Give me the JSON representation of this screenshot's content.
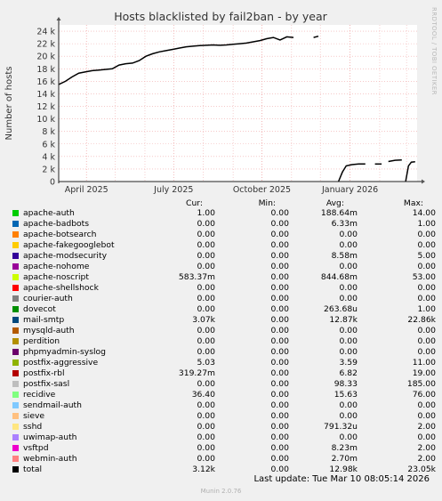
{
  "chart_data": {
    "type": "line",
    "title": "Hosts blacklisted by fail2ban - by year",
    "ylabel": "Number of hosts",
    "ylim": [
      0,
      25000
    ],
    "y_ticks": [
      0,
      2000,
      4000,
      6000,
      8000,
      10000,
      12000,
      14000,
      16000,
      18000,
      20000,
      22000,
      24000
    ],
    "y_tick_labels": [
      "0",
      "2 k",
      "4 k",
      "6 k",
      "8 k",
      "10 k",
      "12 k",
      "14 k",
      "16 k",
      "18 k",
      "20 k",
      "22 k",
      "24 k"
    ],
    "x_range": [
      "2025-03-03",
      "2026-03-12"
    ],
    "x_ticks": [
      "2025-04-01",
      "2025-07-01",
      "2025-10-01",
      "2026-01-01"
    ],
    "x_tick_labels": [
      "April 2025",
      "July 2025",
      "October 2025",
      "January 2026"
    ],
    "grid": true,
    "series": [
      {
        "name": "total",
        "color": "#000000",
        "points": [
          [
            "2025-03-03",
            15500
          ],
          [
            "2025-03-10",
            16000
          ],
          [
            "2025-03-17",
            16700
          ],
          [
            "2025-03-24",
            17300
          ],
          [
            "2025-03-31",
            17500
          ],
          [
            "2025-04-07",
            17700
          ],
          [
            "2025-04-14",
            17800
          ],
          [
            "2025-04-21",
            17900
          ],
          [
            "2025-04-28",
            18000
          ],
          [
            "2025-05-05",
            18600
          ],
          [
            "2025-05-12",
            18800
          ],
          [
            "2025-05-19",
            18900
          ],
          [
            "2025-05-26",
            19300
          ],
          [
            "2025-06-02",
            20000
          ],
          [
            "2025-06-09",
            20400
          ],
          [
            "2025-06-16",
            20700
          ],
          [
            "2025-06-23",
            20900
          ],
          [
            "2025-06-30",
            21100
          ],
          [
            "2025-07-07",
            21300
          ],
          [
            "2025-07-14",
            21500
          ],
          [
            "2025-07-21",
            21600
          ],
          [
            "2025-07-28",
            21700
          ],
          [
            "2025-08-04",
            21750
          ],
          [
            "2025-08-11",
            21800
          ],
          [
            "2025-08-18",
            21750
          ],
          [
            "2025-08-25",
            21800
          ],
          [
            "2025-09-01",
            21900
          ],
          [
            "2025-09-08",
            22000
          ],
          [
            "2025-09-15",
            22100
          ],
          [
            "2025-09-22",
            22300
          ],
          [
            "2025-09-29",
            22500
          ],
          [
            "2025-10-06",
            22800
          ],
          [
            "2025-10-13",
            23000
          ],
          [
            "2025-10-20",
            22600
          ],
          [
            "2025-10-27",
            23100
          ],
          [
            "2025-11-03",
            23000
          ],
          null,
          [
            "2025-11-24",
            23000
          ],
          [
            "2025-11-29",
            23200
          ],
          null,
          [
            "2025-12-20",
            0
          ],
          [
            "2025-12-24",
            1500
          ],
          [
            "2025-12-28",
            2500
          ],
          [
            "2026-01-03",
            2700
          ],
          [
            "2026-01-10",
            2800
          ],
          [
            "2026-01-17",
            2800
          ],
          null,
          [
            "2026-01-27",
            2800
          ],
          [
            "2026-02-03",
            2800
          ],
          null,
          [
            "2026-02-10",
            3200
          ],
          [
            "2026-02-17",
            3400
          ],
          [
            "2026-02-24",
            3450
          ],
          null,
          [
            "2026-02-28",
            0
          ],
          [
            "2026-03-03",
            2500
          ],
          [
            "2026-03-06",
            3100
          ],
          [
            "2026-03-10",
            3150
          ]
        ]
      }
    ]
  },
  "legend": {
    "headers": [
      "Cur:",
      "Min:",
      "Avg:",
      "Max:"
    ],
    "rows": [
      {
        "name": "apache-auth",
        "color": "#00cc00",
        "cur": "1.00",
        "min": "0.00",
        "avg": "188.64m",
        "max": "14.00"
      },
      {
        "name": "apache-badbots",
        "color": "#0066b3",
        "cur": "0.00",
        "min": "0.00",
        "avg": "6.33m",
        "max": "1.00"
      },
      {
        "name": "apache-botsearch",
        "color": "#ff8000",
        "cur": "0.00",
        "min": "0.00",
        "avg": "0.00",
        "max": "0.00"
      },
      {
        "name": "apache-fakegooglebot",
        "color": "#ffcc00",
        "cur": "0.00",
        "min": "0.00",
        "avg": "0.00",
        "max": "0.00"
      },
      {
        "name": "apache-modsecurity",
        "color": "#330099",
        "cur": "0.00",
        "min": "0.00",
        "avg": "8.58m",
        "max": "5.00"
      },
      {
        "name": "apache-nohome",
        "color": "#990099",
        "cur": "0.00",
        "min": "0.00",
        "avg": "0.00",
        "max": "0.00"
      },
      {
        "name": "apache-noscript",
        "color": "#ccff00",
        "cur": "583.37m",
        "min": "0.00",
        "avg": "844.68m",
        "max": "53.00"
      },
      {
        "name": "apache-shellshock",
        "color": "#ff0000",
        "cur": "0.00",
        "min": "0.00",
        "avg": "0.00",
        "max": "0.00"
      },
      {
        "name": "courier-auth",
        "color": "#808080",
        "cur": "0.00",
        "min": "0.00",
        "avg": "0.00",
        "max": "0.00"
      },
      {
        "name": "dovecot",
        "color": "#008f00",
        "cur": "0.00",
        "min": "0.00",
        "avg": "263.68u",
        "max": "1.00"
      },
      {
        "name": "mail-smtp",
        "color": "#00487d",
        "cur": "3.07k",
        "min": "0.00",
        "avg": "12.87k",
        "max": "22.86k"
      },
      {
        "name": "mysqld-auth",
        "color": "#b35a00",
        "cur": "0.00",
        "min": "0.00",
        "avg": "0.00",
        "max": "0.00"
      },
      {
        "name": "perdition",
        "color": "#b38f00",
        "cur": "0.00",
        "min": "0.00",
        "avg": "0.00",
        "max": "0.00"
      },
      {
        "name": "phpmyadmin-syslog",
        "color": "#6b006b",
        "cur": "0.00",
        "min": "0.00",
        "avg": "0.00",
        "max": "0.00"
      },
      {
        "name": "postfix-aggressive",
        "color": "#8fb300",
        "cur": "5.03",
        "min": "0.00",
        "avg": "3.59",
        "max": "11.00"
      },
      {
        "name": "postfix-rbl",
        "color": "#b30000",
        "cur": "319.27m",
        "min": "0.00",
        "avg": "6.82",
        "max": "19.00"
      },
      {
        "name": "postfix-sasl",
        "color": "#bebebe",
        "cur": "0.00",
        "min": "0.00",
        "avg": "98.33",
        "max": "185.00"
      },
      {
        "name": "recidive",
        "color": "#80ff80",
        "cur": "36.40",
        "min": "0.00",
        "avg": "15.63",
        "max": "76.00"
      },
      {
        "name": "sendmail-auth",
        "color": "#80c9ff",
        "cur": "0.00",
        "min": "0.00",
        "avg": "0.00",
        "max": "0.00"
      },
      {
        "name": "sieve",
        "color": "#ffc080",
        "cur": "0.00",
        "min": "0.00",
        "avg": "0.00",
        "max": "0.00"
      },
      {
        "name": "sshd",
        "color": "#ffe680",
        "cur": "0.00",
        "min": "0.00",
        "avg": "791.32u",
        "max": "2.00"
      },
      {
        "name": "uwimap-auth",
        "color": "#aa80ff",
        "cur": "0.00",
        "min": "0.00",
        "avg": "0.00",
        "max": "0.00"
      },
      {
        "name": "vsftpd",
        "color": "#ee00cc",
        "cur": "0.00",
        "min": "0.00",
        "avg": "8.23m",
        "max": "2.00"
      },
      {
        "name": "webmin-auth",
        "color": "#ff8080",
        "cur": "0.00",
        "min": "0.00",
        "avg": "2.70m",
        "max": "2.00"
      },
      {
        "name": "total",
        "color": "#000000",
        "cur": "3.12k",
        "min": "0.00",
        "avg": "12.98k",
        "max": "23.05k"
      }
    ]
  },
  "footer": {
    "last_update": "Last update: Tue Mar 10 08:05:14 2026",
    "munin_version": "Munin 2.0.76",
    "credit": "RRDTOOL / TOBI OETIKER"
  }
}
